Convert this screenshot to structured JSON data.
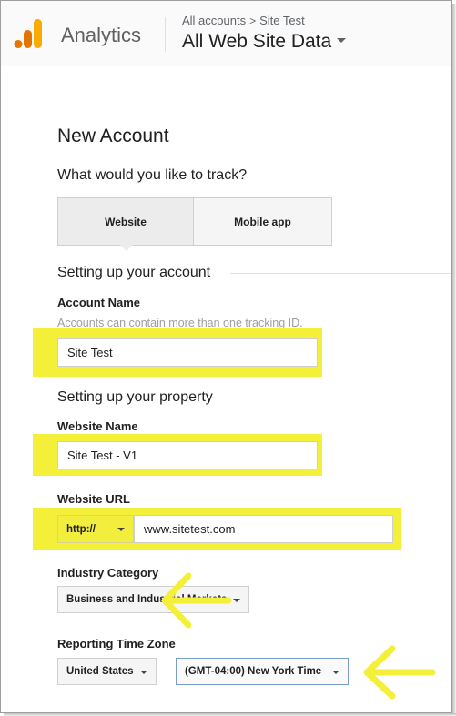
{
  "header": {
    "app_title": "Analytics",
    "breadcrumb": {
      "account": "All accounts",
      "separator": ">",
      "property": "Site Test"
    },
    "view_name": "All Web Site Data"
  },
  "main": {
    "title": "New Account",
    "track_question": "What would you like to track?",
    "track_options": [
      "Website",
      "Mobile app"
    ],
    "selected_track_option": "Website",
    "account_section": {
      "heading": "Setting up your account",
      "account_name_label": "Account Name",
      "account_name_help": "Accounts can contain more than one tracking ID.",
      "account_name_value": "Site Test"
    },
    "property_section": {
      "heading": "Setting up your property",
      "website_name_label": "Website Name",
      "website_name_value": "Site Test - V1",
      "website_url_label": "Website URL",
      "protocol_value": "http://",
      "website_url_value": "www.sitetest.com",
      "industry_label": "Industry Category",
      "industry_value": "Business and Industrial Markets",
      "timezone_label": "Reporting Time Zone",
      "timezone_country": "United States",
      "timezone_value": "(GMT-04:00) New York Time"
    }
  },
  "colors": {
    "highlight": "#f4f03a",
    "logo_orange": "#f57c00",
    "logo_yellow": "#f9ab00"
  },
  "icons": [
    "analytics-logo-icon",
    "chevron-right-icon",
    "caret-down-icon",
    "arrow-left-icon"
  ]
}
